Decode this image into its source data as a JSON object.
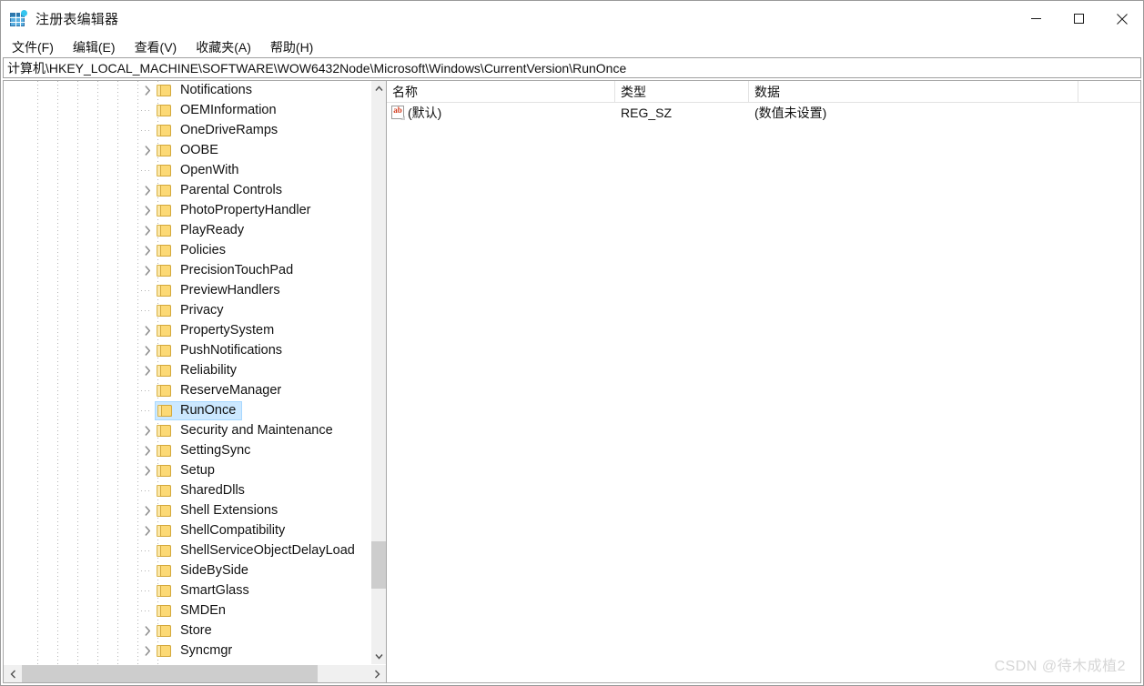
{
  "window": {
    "title": "注册表编辑器",
    "app_icon": "registry-editor-icon",
    "controls": {
      "minimize": "minimize-icon",
      "maximize": "maximize-icon",
      "close": "close-icon"
    }
  },
  "menubar": {
    "items": [
      {
        "label": "文件(F)"
      },
      {
        "label": "编辑(E)"
      },
      {
        "label": "查看(V)"
      },
      {
        "label": "收藏夹(A)"
      },
      {
        "label": "帮助(H)"
      }
    ]
  },
  "address": {
    "path": "计算机\\HKEY_LOCAL_MACHINE\\SOFTWARE\\WOW6432Node\\Microsoft\\Windows\\CurrentVersion\\RunOnce"
  },
  "tree": {
    "items": [
      {
        "label": "Notifications",
        "expandable": true,
        "selected": false
      },
      {
        "label": "OEMInformation",
        "expandable": false,
        "selected": false
      },
      {
        "label": "OneDriveRamps",
        "expandable": false,
        "selected": false
      },
      {
        "label": "OOBE",
        "expandable": true,
        "selected": false
      },
      {
        "label": "OpenWith",
        "expandable": false,
        "selected": false
      },
      {
        "label": "Parental Controls",
        "expandable": true,
        "selected": false
      },
      {
        "label": "PhotoPropertyHandler",
        "expandable": true,
        "selected": false
      },
      {
        "label": "PlayReady",
        "expandable": true,
        "selected": false
      },
      {
        "label": "Policies",
        "expandable": true,
        "selected": false
      },
      {
        "label": "PrecisionTouchPad",
        "expandable": true,
        "selected": false
      },
      {
        "label": "PreviewHandlers",
        "expandable": false,
        "selected": false
      },
      {
        "label": "Privacy",
        "expandable": false,
        "selected": false
      },
      {
        "label": "PropertySystem",
        "expandable": true,
        "selected": false
      },
      {
        "label": "PushNotifications",
        "expandable": true,
        "selected": false
      },
      {
        "label": "Reliability",
        "expandable": true,
        "selected": false
      },
      {
        "label": "ReserveManager",
        "expandable": false,
        "selected": false
      },
      {
        "label": "RunOnce",
        "expandable": false,
        "selected": true
      },
      {
        "label": "Security and Maintenance",
        "expandable": true,
        "selected": false
      },
      {
        "label": "SettingSync",
        "expandable": true,
        "selected": false
      },
      {
        "label": "Setup",
        "expandable": true,
        "selected": false
      },
      {
        "label": "SharedDlls",
        "expandable": false,
        "selected": false
      },
      {
        "label": "Shell Extensions",
        "expandable": true,
        "selected": false
      },
      {
        "label": "ShellCompatibility",
        "expandable": true,
        "selected": false
      },
      {
        "label": "ShellServiceObjectDelayLoad",
        "expandable": false,
        "selected": false
      },
      {
        "label": "SideBySide",
        "expandable": false,
        "selected": false
      },
      {
        "label": "SmartGlass",
        "expandable": false,
        "selected": false
      },
      {
        "label": "SMDEn",
        "expandable": false,
        "selected": false
      },
      {
        "label": "Store",
        "expandable": true,
        "selected": false
      },
      {
        "label": "Syncmgr",
        "expandable": true,
        "selected": false
      }
    ]
  },
  "list": {
    "columns": [
      {
        "label": "名称"
      },
      {
        "label": "类型"
      },
      {
        "label": "数据"
      }
    ],
    "rows": [
      {
        "icon": "string-value-icon",
        "name": "(默认)",
        "type": "REG_SZ",
        "data": "(数值未设置)"
      }
    ]
  },
  "watermark": {
    "text": "CSDN @待木成植2"
  },
  "colors": {
    "selection_fill": "#cce8ff",
    "selection_border": "#a8d8ff",
    "folder_front": "#fcd975",
    "folder_back": "#fbe7a8",
    "icon_accent": "#35c5ef",
    "scrollbar_thumb": "#cdcdcd"
  }
}
